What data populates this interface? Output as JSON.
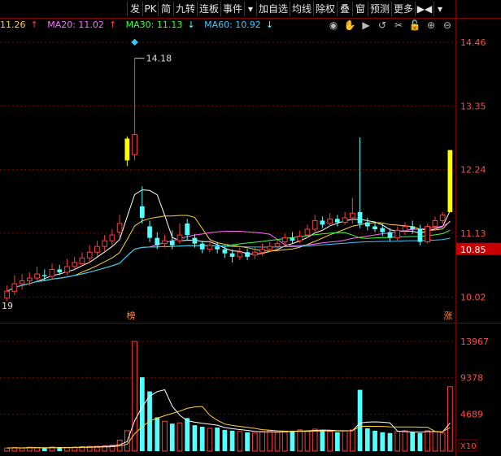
{
  "toolbar": {
    "buttons": [
      "发",
      "PK",
      "简",
      "九转",
      "连板",
      "事件",
      "▾",
      "加自选",
      "均线",
      "除权",
      "叠",
      "窗",
      "预测",
      "更多",
      "▶◀",
      "▾"
    ]
  },
  "ma_row": {
    "ma10": {
      "label": "11.26",
      "arrow": "↑",
      "color": "#ffd23c"
    },
    "ma20": {
      "label": "MA20: 11.02",
      "arrow": "↑",
      "color": "#ff6cff"
    },
    "ma30": {
      "label": "MA30: 11.13",
      "arrow": "↓",
      "color": "#3cff3c"
    },
    "ma60": {
      "label": "MA60: 10.92",
      "arrow": "↓",
      "color": "#3cc8ff"
    }
  },
  "tools_icons": [
    "eye-icon",
    "hand-icon",
    "play-icon",
    "refresh-icon",
    "scissors-icon",
    "lock-icon",
    "zoom-in-icon",
    "zoom-out-icon"
  ],
  "price_axis": {
    "labels": [
      "14.46",
      "13.35",
      "12.24",
      "11.13",
      "10.02"
    ],
    "current": "10.85"
  },
  "volume_axis": {
    "labels": [
      "13967",
      "9378",
      "4689"
    ],
    "unit": "X10"
  },
  "annotations": {
    "high": "14.18",
    "left_tail": "19",
    "marker_bang": "榜",
    "marker_zhang": "涨"
  },
  "colors": {
    "up": "#ff3c3c",
    "down": "#54ffff",
    "limit_up": "#ffff00",
    "grid": "#800000"
  },
  "chart_data": {
    "type": "candlestick",
    "ylim": [
      9.6,
      14.6
    ],
    "candles": [
      [
        10.0,
        10.12,
        9.95,
        10.22
      ],
      [
        10.12,
        10.25,
        10.05,
        10.4
      ],
      [
        10.25,
        10.3,
        10.15,
        10.42
      ],
      [
        10.3,
        10.35,
        10.22,
        10.45
      ],
      [
        10.35,
        10.42,
        10.3,
        10.55
      ],
      [
        10.4,
        10.38,
        10.3,
        10.5
      ],
      [
        10.38,
        10.5,
        10.32,
        10.6
      ],
      [
        10.5,
        10.45,
        10.4,
        10.58
      ],
      [
        10.45,
        10.55,
        10.4,
        10.68
      ],
      [
        10.55,
        10.62,
        10.48,
        10.72
      ],
      [
        10.6,
        10.7,
        10.55,
        10.8
      ],
      [
        10.7,
        10.8,
        10.62,
        10.92
      ],
      [
        10.8,
        10.9,
        10.72,
        11.0
      ],
      [
        10.9,
        11.0,
        10.82,
        11.1
      ],
      [
        11.0,
        11.1,
        10.92,
        11.2
      ],
      [
        11.15,
        11.3,
        11.05,
        11.45
      ],
      [
        12.4,
        12.78,
        12.3,
        12.82
      ],
      [
        12.5,
        12.85,
        12.4,
        14.18
      ],
      [
        11.6,
        11.4,
        11.3,
        11.95
      ],
      [
        11.25,
        11.05,
        10.98,
        11.35
      ],
      [
        11.05,
        10.92,
        10.85,
        11.15
      ],
      [
        10.95,
        11.0,
        10.88,
        11.1
      ],
      [
        11.0,
        10.92,
        10.85,
        11.18
      ],
      [
        11.0,
        11.1,
        10.95,
        11.3
      ],
      [
        11.3,
        11.1,
        11.0,
        11.38
      ],
      [
        11.05,
        10.95,
        10.88,
        11.12
      ],
      [
        10.95,
        10.85,
        10.78,
        11.0
      ],
      [
        10.85,
        10.92,
        10.8,
        11.0
      ],
      [
        10.9,
        10.85,
        10.78,
        10.98
      ],
      [
        10.85,
        10.78,
        10.7,
        10.92
      ],
      [
        10.78,
        10.72,
        10.62,
        10.85
      ],
      [
        10.72,
        10.8,
        10.66,
        10.88
      ],
      [
        10.8,
        10.72,
        10.66,
        10.86
      ],
      [
        10.75,
        10.8,
        10.68,
        10.88
      ],
      [
        10.8,
        10.85,
        10.74,
        10.95
      ],
      [
        10.85,
        10.9,
        10.8,
        10.98
      ],
      [
        10.9,
        10.95,
        10.84,
        11.02
      ],
      [
        10.98,
        11.05,
        10.9,
        11.12
      ],
      [
        11.05,
        11.0,
        10.95,
        11.15
      ],
      [
        11.0,
        11.08,
        10.96,
        11.18
      ],
      [
        11.1,
        11.2,
        11.05,
        11.28
      ],
      [
        11.2,
        11.35,
        11.12,
        11.45
      ],
      [
        11.35,
        11.28,
        11.22,
        11.42
      ],
      [
        11.3,
        11.38,
        11.25,
        11.48
      ],
      [
        11.38,
        11.32,
        11.25,
        11.45
      ],
      [
        11.32,
        11.4,
        11.28,
        11.5
      ],
      [
        11.4,
        11.48,
        11.3,
        11.75
      ],
      [
        11.5,
        11.3,
        11.22,
        12.8
      ],
      [
        11.32,
        11.25,
        11.18,
        11.4
      ],
      [
        11.25,
        11.2,
        11.15,
        11.32
      ],
      [
        11.22,
        11.15,
        11.08,
        11.3
      ],
      [
        11.15,
        11.05,
        10.98,
        11.22
      ],
      [
        11.05,
        11.18,
        11.0,
        11.25
      ],
      [
        11.18,
        11.25,
        11.1,
        11.32
      ],
      [
        11.25,
        11.2,
        11.12,
        11.35
      ],
      [
        11.2,
        10.98,
        10.92,
        11.28
      ],
      [
        10.98,
        11.25,
        10.95,
        11.3
      ],
      [
        11.25,
        11.35,
        11.18,
        11.42
      ],
      [
        11.35,
        11.45,
        11.3,
        11.5
      ],
      [
        11.5,
        12.58,
        11.5,
        12.58
      ]
    ],
    "volumes": [
      400,
      450,
      380,
      500,
      420,
      380,
      520,
      450,
      480,
      520,
      560,
      600,
      620,
      680,
      750,
      1400,
      2600,
      13967,
      9400,
      7600,
      4300,
      3800,
      3500,
      3600,
      4200,
      3300,
      3100,
      2900,
      3000,
      2700,
      2600,
      2500,
      2400,
      2300,
      2500,
      2600,
      2400,
      2500,
      2600,
      2700,
      2600,
      2800,
      2700,
      2500,
      2400,
      2600,
      2700,
      7800,
      2900,
      2600,
      2400,
      2300,
      2500,
      2600,
      2400,
      2300,
      2600,
      2500,
      2300,
      8200
    ]
  }
}
